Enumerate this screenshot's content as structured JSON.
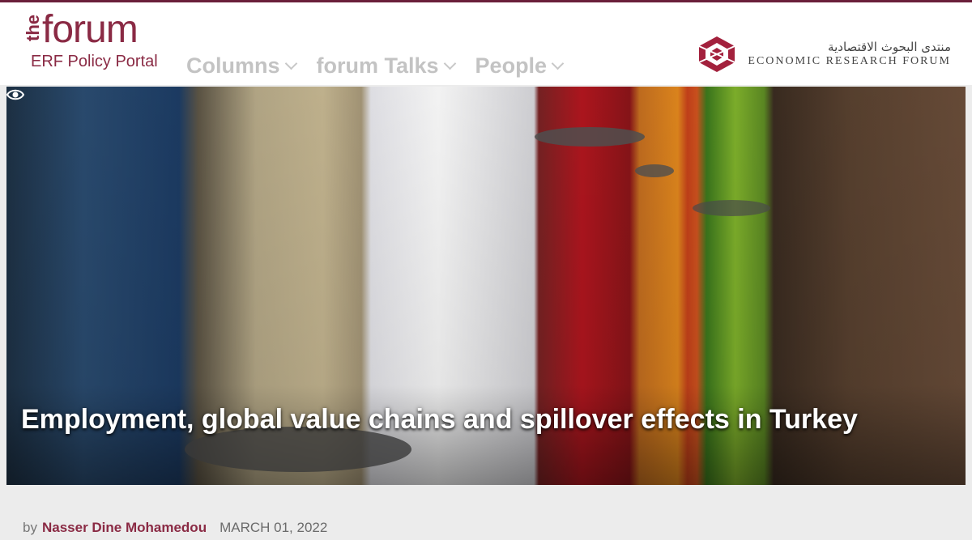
{
  "logo": {
    "the": "the",
    "word": "forum",
    "subtitle": "ERF Policy Portal"
  },
  "nav": {
    "items": [
      "Columns",
      "forum Talks",
      "People"
    ]
  },
  "erf": {
    "arabic": "منتدى البحوث الاقتصادية",
    "english": "ECONOMIC RESEARCH FORUM"
  },
  "article": {
    "title": "Employment, global value chains and spillover effects in Turkey",
    "by": "by",
    "author": "Nasser Dine Mohamedou",
    "date": "MARCH 01, 2022"
  },
  "icons": {
    "view": "eye-icon",
    "dropdown": "chevron-down-icon",
    "erf_logo": "erf-logo-icon"
  },
  "colors": {
    "brand": "#8a2a44",
    "nav": "#c3c3c3",
    "top_border": "#6a1f3a"
  }
}
